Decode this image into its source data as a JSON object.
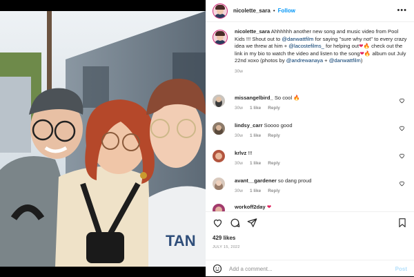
{
  "post": {
    "username": "nicolette_sara",
    "separator": "•",
    "follow_label": "Follow",
    "more_label": "•••",
    "caption": {
      "username": "nicolette_sara",
      "part1": " Ahhhhhh another new song and music video from Pool Kids !!! Shout out to ",
      "mention1": "@danwattfilm",
      "part2": " for saying \"sure why not\" to every crazy idea we threw at him + ",
      "mention2": "@lacostefilms_",
      "part3": " for helping out",
      "part4": " check out the link in my bio to watch the video and listen to the song",
      "part5": " album out July 22nd xoxo (photos by ",
      "mention3": "@andrewanaya",
      "part6": " + ",
      "mention4": "@danwattfilm",
      "part7": ")",
      "heart": "❤",
      "fire": "🔥",
      "age": "30w"
    },
    "comments": [
      {
        "username": "missangelbird_",
        "text": " So cool ",
        "emoji": "🔥",
        "age": "30w",
        "likes": "1 like",
        "reply": "Reply"
      },
      {
        "username": "lindsy_carr",
        "text": " Soooo good",
        "emoji": "",
        "age": "30w",
        "likes": "1 like",
        "reply": "Reply"
      },
      {
        "username": "krlvz",
        "text": " !!!",
        "emoji": "",
        "age": "30w",
        "likes": "1 like",
        "reply": "Reply"
      },
      {
        "username": "avant__gardener",
        "text": " so dang proud",
        "emoji": "",
        "age": "30w",
        "likes": "1 like",
        "reply": "Reply"
      },
      {
        "username": "workoff2day",
        "text": " ",
        "emoji": "❤",
        "age": "",
        "likes": "",
        "reply": ""
      }
    ],
    "likes_count": "429 likes",
    "date": "JULY 15, 2022",
    "add_comment_placeholder": "Add a comment...",
    "post_button": "Post",
    "icons": [
      "heart-icon",
      "comment-icon",
      "share-icon",
      "bookmark-icon",
      "emoji-icon",
      "more-icon"
    ],
    "colors": {
      "link": "#00376b",
      "follow": "#0095f6",
      "post_disabled": "#b2dffc",
      "story_ring": "#d22a7a"
    }
  }
}
